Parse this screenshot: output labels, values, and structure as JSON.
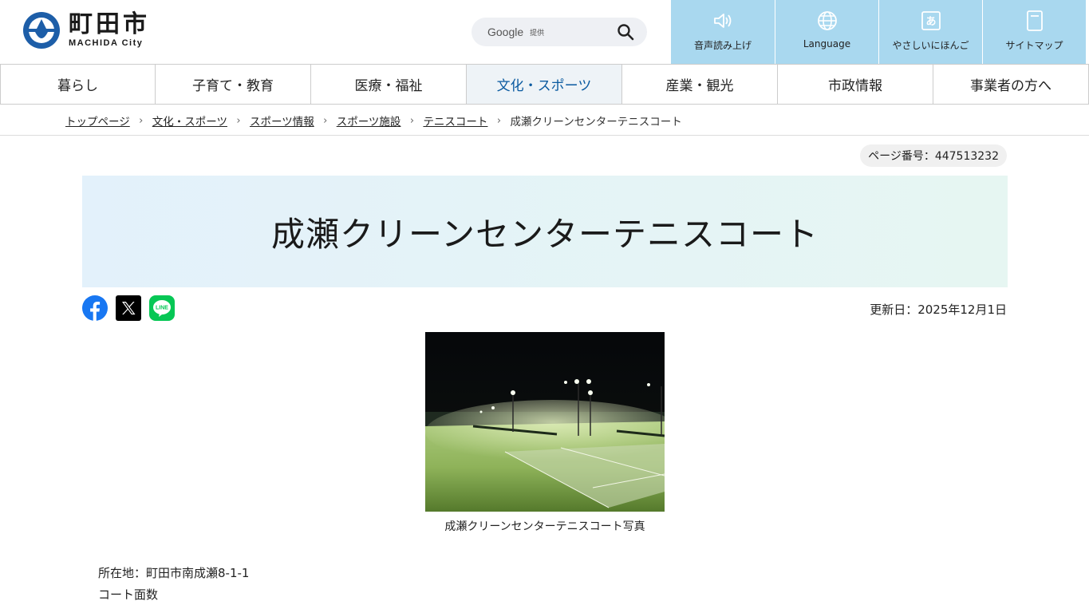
{
  "header": {
    "logo_main": "町田市",
    "logo_sub": "MACHIDA City",
    "search": {
      "google_label": "Google",
      "provided_label": "提供"
    },
    "util_nav": [
      {
        "label": "音声読み上げ",
        "icon": "speaker-icon"
      },
      {
        "label": "Language",
        "icon": "globe-icon"
      },
      {
        "label": "やさしいにほんご",
        "icon": "hiragana-a-icon"
      },
      {
        "label": "サイトマップ",
        "icon": "sitemap-icon"
      }
    ]
  },
  "gnav": [
    {
      "label": "暮らし"
    },
    {
      "label": "子育て・教育"
    },
    {
      "label": "医療・福祉"
    },
    {
      "label": "文化・スポーツ"
    },
    {
      "label": "産業・観光"
    },
    {
      "label": "市政情報"
    },
    {
      "label": "事業者の方へ"
    }
  ],
  "breadcrumb": {
    "items": [
      "トップページ",
      "文化・スポーツ",
      "スポーツ情報",
      "スポーツ施設",
      "テニスコート"
    ],
    "current": "成瀬クリーンセンターテニスコート"
  },
  "page_number": "ページ番号：447513232",
  "title": "成瀬クリーンセンターテニスコート",
  "updated": "更新日：2025年12月1日",
  "share_icons": [
    "facebook-icon",
    "x-icon",
    "line-icon"
  ],
  "line_logo_text": "LINE",
  "photo_caption": "成瀬クリーンセンターテニスコート写真",
  "info": {
    "address": "所在地：町田市南成瀬8-1-1",
    "courts_label": "コート面数"
  },
  "colors": {
    "util_bg": "#a9d8ef",
    "brand": "#1d5ea8",
    "active_nav": "#0a5aa0"
  }
}
